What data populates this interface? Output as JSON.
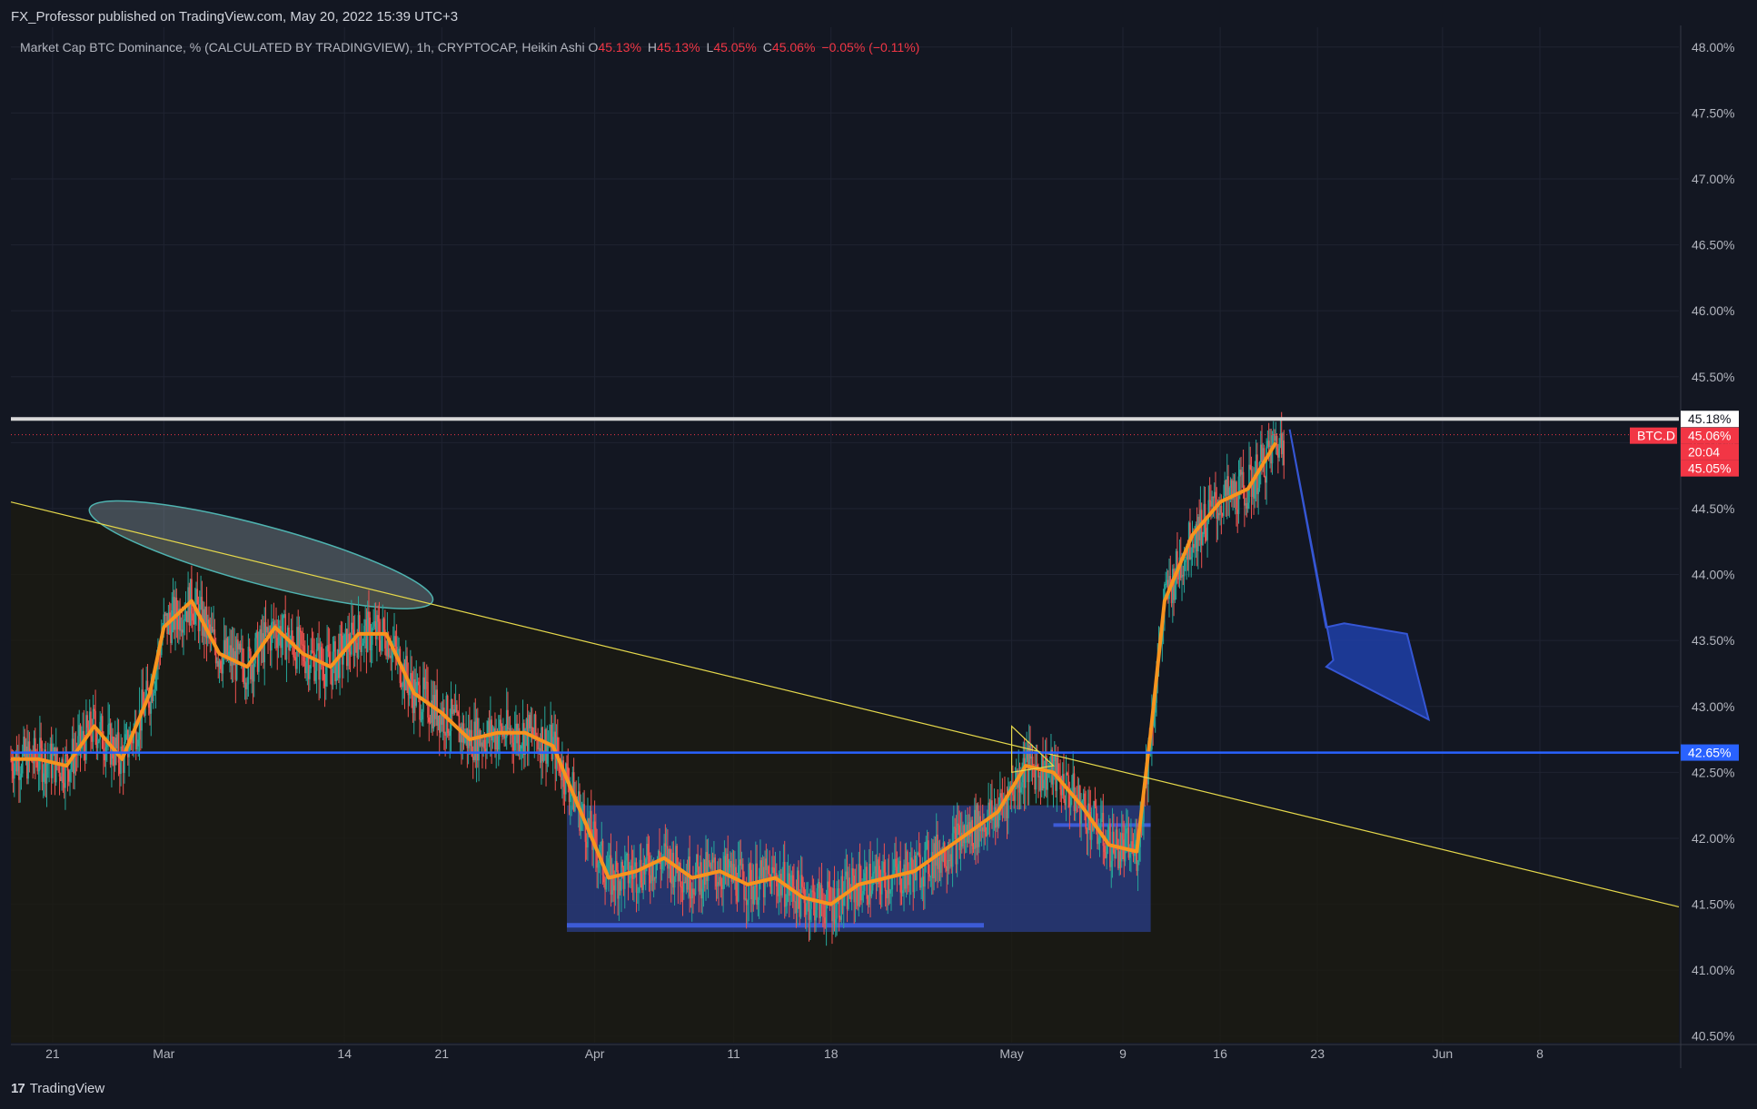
{
  "header": {
    "publisher_line": "FX_Professor published on TradingView.com, May 20, 2022 15:39 UTC+3"
  },
  "legend": {
    "title": "Market Cap BTC Dominance, % (CALCULATED BY TRADINGVIEW), 1h, CRYPTOCAP, Heikin Ashi",
    "o_label": "O",
    "o_value": "45.13%",
    "h_label": "H",
    "h_value": "45.13%",
    "l_label": "L",
    "l_value": "45.05%",
    "c_label": "C",
    "c_value": "45.06%",
    "change": "−0.05% (−0.11%)"
  },
  "footer": {
    "brand": "TradingView"
  },
  "colors": {
    "background": "#131722",
    "candle_up": "#26a69a",
    "candle_down": "#ef5350",
    "moving_average": "#f7931e",
    "support_line": "#2962ff",
    "resistance_line": "#d9d9d9",
    "trendline": "#e5d84b",
    "range_box": "#2f4bb5",
    "arrow": "#1e3fa8",
    "price_label": "#f23645"
  },
  "price_labels": {
    "resistance": "45.18%",
    "symbol": "BTC.D",
    "last": "45.06%",
    "countdown": "20:04",
    "low": "45.05%",
    "support": "42.65%"
  },
  "chart_data": {
    "type": "line",
    "title": "Market Cap BTC Dominance, % (CALCULATED BY TRADINGVIEW), 1h, CRYPTOCAP, Heikin Ashi",
    "xlabel": "",
    "ylabel": "",
    "chart_style": "Heikin Ashi candles (1h) with moving average",
    "x_ticks": [
      "21",
      "Mar",
      "14",
      "21",
      "Apr",
      "11",
      "18",
      "May",
      "9",
      "16",
      "23",
      "Jun",
      "8"
    ],
    "y_ticks": [
      "48.00%",
      "47.50%",
      "47.00%",
      "46.50%",
      "46.00%",
      "45.50%",
      "45.00%",
      "44.50%",
      "44.00%",
      "43.50%",
      "43.00%",
      "42.50%",
      "42.00%",
      "41.50%",
      "41.00%",
      "40.50%"
    ],
    "ylim": [
      40.45,
      48.15
    ],
    "xlim": [
      "2022-02-18",
      "2022-06-18"
    ],
    "grid": true,
    "series": [
      {
        "name": "",
        "x": [
          "2022-02-18",
          "2022-02-20",
          "2022-02-22",
          "2022-02-24",
          "2022-02-26",
          "2022-02-28",
          "2022-03-01",
          "2022-03-03",
          "2022-03-05",
          "2022-03-07",
          "2022-03-09",
          "2022-03-11",
          "2022-03-13",
          "2022-03-15",
          "2022-03-17",
          "2022-03-19",
          "2022-03-21",
          "2022-03-23",
          "2022-03-25",
          "2022-03-27",
          "2022-03-29",
          "2022-03-31",
          "2022-04-02",
          "2022-04-04",
          "2022-04-06",
          "2022-04-08",
          "2022-04-10",
          "2022-04-12",
          "2022-04-14",
          "2022-04-16",
          "2022-04-18",
          "2022-04-20",
          "2022-04-22",
          "2022-04-24",
          "2022-04-26",
          "2022-04-28",
          "2022-04-30",
          "2022-05-02",
          "2022-05-04",
          "2022-05-06",
          "2022-05-08",
          "2022-05-10",
          "2022-05-11",
          "2022-05-12",
          "2022-05-14",
          "2022-05-16",
          "2022-05-18",
          "2022-05-20"
        ],
        "values": [
          42.6,
          42.6,
          42.55,
          42.85,
          42.6,
          43.1,
          43.6,
          43.8,
          43.4,
          43.3,
          43.6,
          43.4,
          43.3,
          43.55,
          43.55,
          43.1,
          42.95,
          42.75,
          42.8,
          42.8,
          42.7,
          42.2,
          41.7,
          41.75,
          41.85,
          41.7,
          41.75,
          41.65,
          41.7,
          41.55,
          41.5,
          41.65,
          41.7,
          41.75,
          41.9,
          42.05,
          42.2,
          42.55,
          42.5,
          42.25,
          41.95,
          41.9,
          42.8,
          43.8,
          44.3,
          44.55,
          44.65,
          45.0
        ]
      }
    ],
    "horizontal_levels": [
      {
        "value": 45.18,
        "label": "45.18%"
      },
      {
        "value": 42.65,
        "label": "42.65%"
      }
    ],
    "last_price": 45.06,
    "annotations": [
      "descending trendline from top-left to bottom-right",
      "range box from late March to May 11",
      "ellipse over early March highs",
      "downward arrow projection after May 20"
    ]
  }
}
